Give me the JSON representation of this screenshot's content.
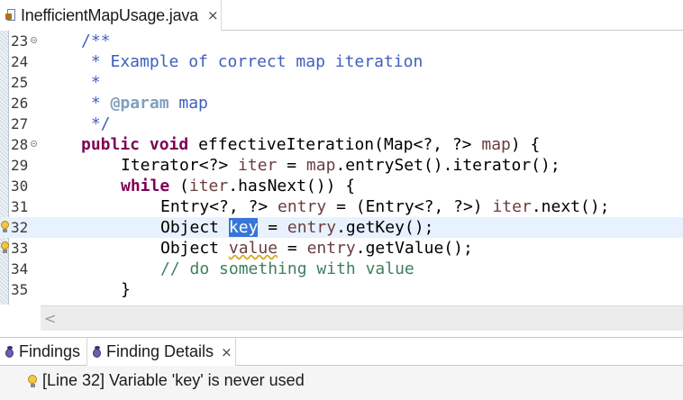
{
  "editor_tab": {
    "title": "InefficientMapUsage.java",
    "close": "×"
  },
  "lines": [
    {
      "num": "23",
      "fold": true
    },
    {
      "num": "24"
    },
    {
      "num": "25"
    },
    {
      "num": "26"
    },
    {
      "num": "27"
    },
    {
      "num": "28",
      "fold": true
    },
    {
      "num": "29"
    },
    {
      "num": "30"
    },
    {
      "num": "31"
    },
    {
      "num": "32",
      "warn": true
    },
    {
      "num": "33",
      "warn": true
    },
    {
      "num": "34"
    },
    {
      "num": "35"
    }
  ],
  "code": {
    "l23": "/**",
    "l24": " * Example of correct map iteration",
    "l25": " *",
    "l26_a": " * ",
    "l26_tag": "@param",
    "l26_b": " map",
    "l27": " */",
    "l28_kw1": "public",
    "l28_kw2": "void",
    "l28_a": "effectiveIteration(Map<?, ?> ",
    "l28_var": "map",
    "l28_b": ") {",
    "l29_a": "Iterator<?> ",
    "l29_var1": "iter",
    "l29_b": " = ",
    "l29_var2": "map",
    "l29_c": ".entrySet().iterator();",
    "l30_kw": "while",
    "l30_a": " (",
    "l30_var": "iter",
    "l30_b": ".hasNext()) {",
    "l31_a": "Entry<?, ?> ",
    "l31_var1": "entry",
    "l31_b": " = (Entry<?, ?>) ",
    "l31_var2": "iter",
    "l31_c": ".next();",
    "l32_a": "Object ",
    "l32_sel": "key",
    "l32_b": " = ",
    "l32_var": "entry",
    "l32_c": ".getKey();",
    "l33_a": "Object ",
    "l33_sq": "value",
    "l33_b": " = ",
    "l33_var": "entry",
    "l33_c": ".getValue();",
    "l34": "// do something with value",
    "l35": "}"
  },
  "scroll": {
    "left_arrow": "<"
  },
  "bottom_tabs": {
    "findings": "Findings",
    "finding_details": "Finding Details",
    "close": "×"
  },
  "details": {
    "message": "[Line 32] Variable 'key' is never used"
  },
  "colors": {
    "comment": "#3f5fbf",
    "keyword": "#7f0055",
    "selection": "#3875d7",
    "current_line": "#e8f2fe",
    "line_comment": "#3f7f5f"
  }
}
